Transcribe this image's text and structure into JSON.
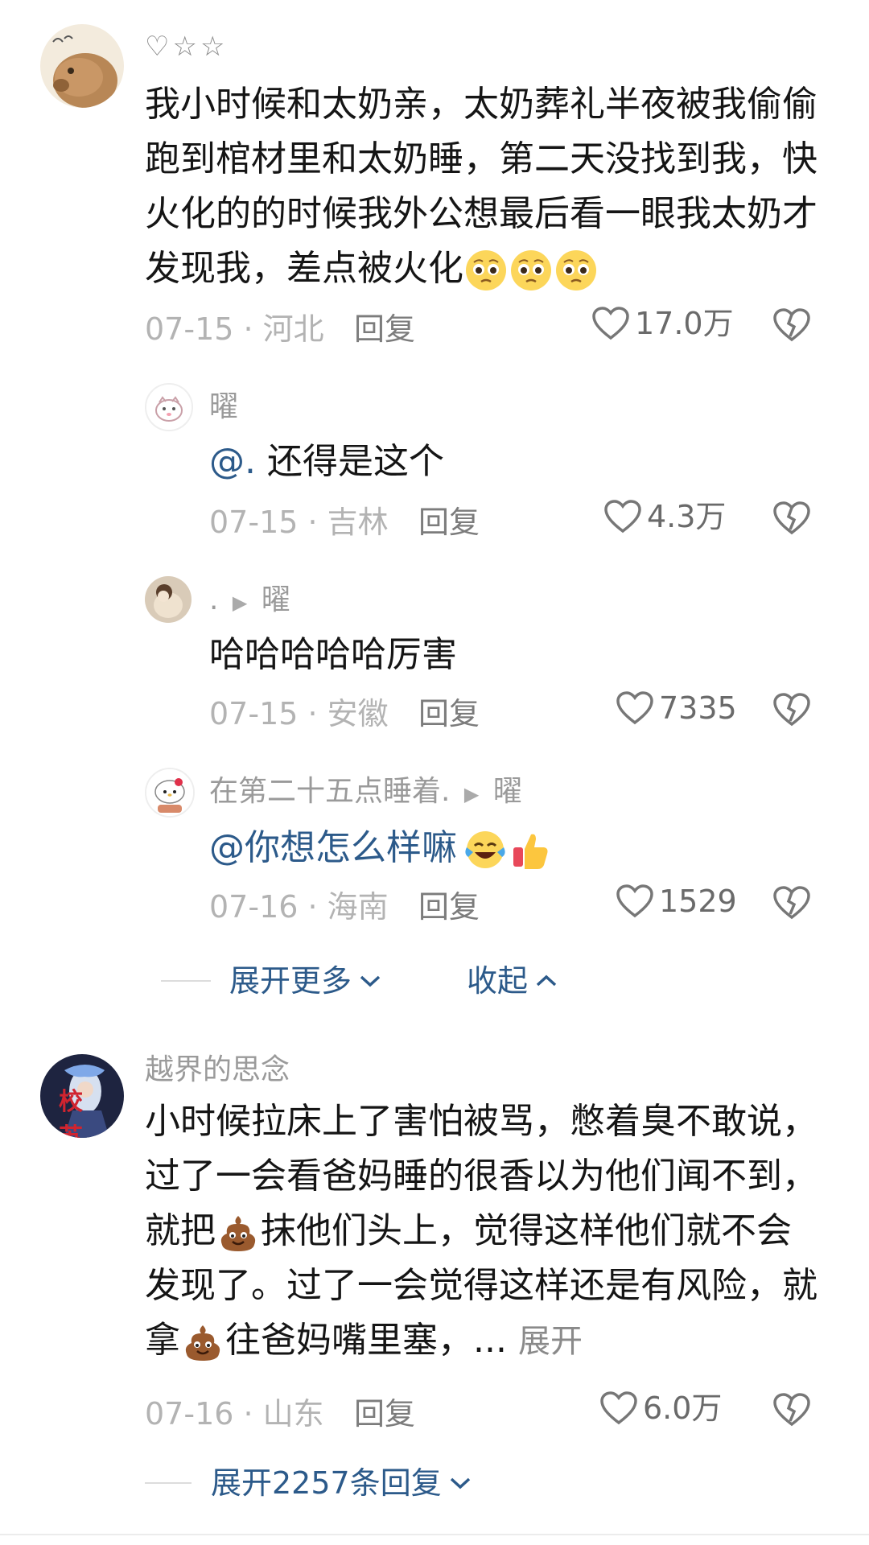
{
  "top_comment": {
    "rating_stars": "♡☆☆",
    "content": "我小时候和太奶亲，太奶葬礼半夜被我偷偷跑到棺材里和太奶睡，第二天没找到我，快火化的的时候我外公想最后看一眼我太奶才发现我，差点被火化",
    "content_lines": [
      "我小时候和太奶亲，太奶葬礼半夜被我偷偷",
      "跑到棺材里和太奶睡，第二天没找到我，快",
      "火化的的时候我外公想最后看一眼我太奶才",
      "发现我，差点被火化"
    ],
    "emojis": [
      "pleading-face-emoji",
      "pleading-face-emoji",
      "pleading-face-emoji"
    ],
    "date": "07-15",
    "location": "河北",
    "reply_label": "回复",
    "likes": "17.0万"
  },
  "replies": [
    {
      "name": "曜",
      "mention": "@.",
      "content": " 还得是这个",
      "date": "07-15",
      "location": "吉林",
      "reply_label": "回复",
      "likes": "4.3万"
    },
    {
      "name": ".",
      "reply_to": "曜",
      "content": "哈哈哈哈哈厉害",
      "date": "07-15",
      "location": "安徽",
      "reply_label": "回复",
      "likes": "7335"
    },
    {
      "name": "在第二十五点睡着.",
      "reply_to": "曜",
      "mention": "@你想怎么样嘛",
      "emojis": [
        "laughing-tears-emoji",
        "thumbs-up-emoji"
      ],
      "date": "07-16",
      "location": "海南",
      "reply_label": "回复",
      "likes": "1529"
    }
  ],
  "expand_more": "展开更多",
  "collapse": "收起",
  "second_comment": {
    "name": "越界的思念",
    "avatar_text": "校 苏",
    "content_lines": [
      "小时候拉床上了害怕被骂，憋着臭不敢说，",
      "过了一会看爸妈睡的很香以为他们闻不到，",
      [
        "就把",
        "抹他们头上，觉得这样他们就不会"
      ],
      "发现了。过了一会觉得这样还是有风险，就",
      [
        "拿",
        "往爸妈嘴里塞，... "
      ]
    ],
    "emojis": [
      "poop-emoji"
    ],
    "expand_text": "展开",
    "date": "07-16",
    "location": "山东",
    "reply_label": "回复",
    "likes": "6.0万"
  },
  "expand_replies": "展开2257条回复",
  "separator": " · ",
  "colors": {
    "link": "#2c5a8a",
    "meta": "#b3b3b3",
    "text": "#151515"
  }
}
